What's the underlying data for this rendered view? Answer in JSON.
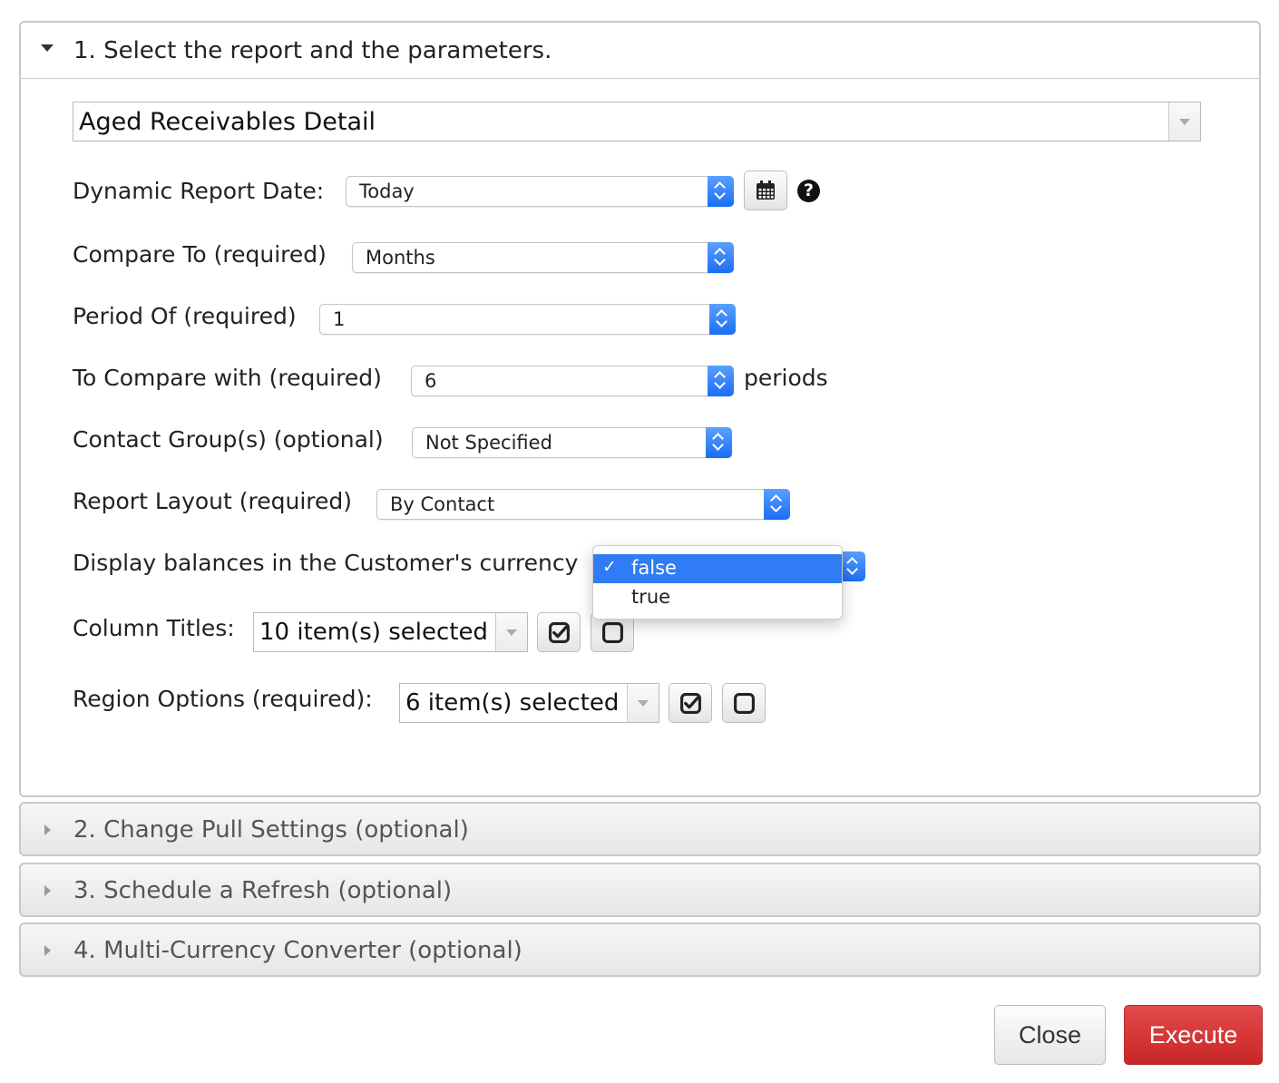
{
  "section1": {
    "title": "1. Select the report and the parameters.",
    "report_name": "Aged Receivables Detail"
  },
  "fields": {
    "dynamic_report_date": {
      "label": "Dynamic Report Date:",
      "value": "Today"
    },
    "compare_to": {
      "label": "Compare To (required)",
      "value": "Months"
    },
    "period_of": {
      "label": "Period Of (required)",
      "value": "1"
    },
    "to_compare_with": {
      "label": "To Compare with (required)",
      "value": "6",
      "suffix": "periods"
    },
    "contact_groups": {
      "label": "Contact Group(s) (optional)",
      "value": "Not Specified"
    },
    "report_layout": {
      "label": "Report Layout (required)",
      "value": "By Contact"
    },
    "display_balances": {
      "label": "Display balances in the Customer's currency",
      "options": [
        "false",
        "true"
      ],
      "selected_check": "✓"
    },
    "column_titles": {
      "label": "Column Titles:",
      "value": "10 item(s) selected"
    },
    "region_options": {
      "label": "Region Options (required):",
      "value": "6 item(s) selected"
    }
  },
  "icons": {
    "help": "?"
  },
  "sections": [
    {
      "title": "2. Change Pull Settings (optional)"
    },
    {
      "title": "3. Schedule a Refresh (optional)"
    },
    {
      "title": "4. Multi-Currency Converter (optional)"
    }
  ],
  "footer": {
    "close_label": "Close",
    "execute_label": "Execute"
  },
  "colors": {
    "accent": "#2f7cf6",
    "execute": "#d03030",
    "border": "#c8c8c8"
  }
}
